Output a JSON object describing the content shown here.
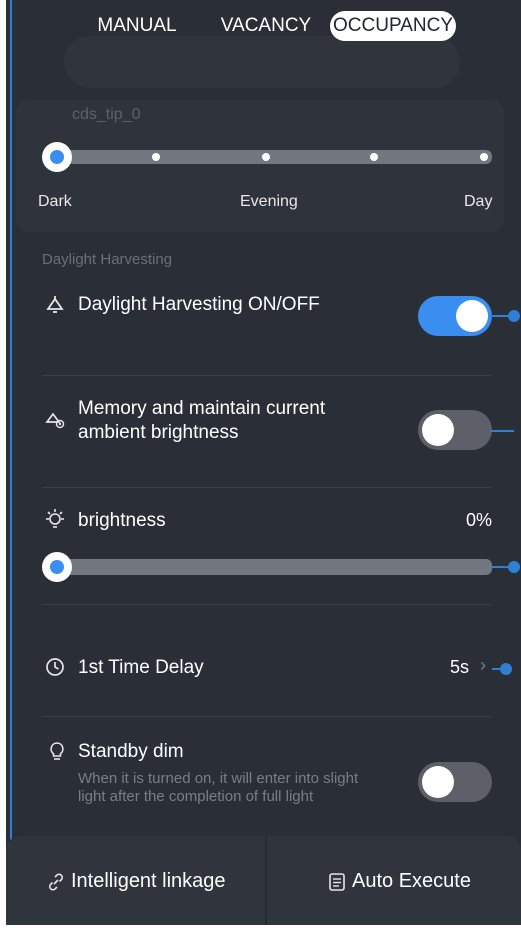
{
  "mode_tabs": [
    "MANUAL",
    "VACANCY",
    "OCCUPANCY"
  ],
  "active_tab": "OCCUPANCY",
  "cds": {
    "tip": "cds_tip_0",
    "labels": [
      "Dark",
      "Evening",
      "Day"
    ],
    "level_index": 0
  },
  "daylight": {
    "section_title": "Daylight Harvesting",
    "onoff_label": "Daylight Harvesting ON/OFF",
    "onoff_state": true,
    "memory_label_line1": "Memory and maintain current",
    "memory_label_line2": "ambient brightness",
    "memory_state": false
  },
  "brightness": {
    "label": "brightness",
    "value_text": "0%",
    "value": 0
  },
  "delay": {
    "label": "1st Time Delay",
    "value_text": "5s",
    "chevron": "›"
  },
  "standby": {
    "label": "Standby dim",
    "description": "When it is turned on, it will enter into slight light after the completion of full light",
    "state": false
  },
  "footer": {
    "intelligent_label": "Intelligent linkage",
    "auto_label": "Auto Execute"
  },
  "colors": {
    "accent": "#3a8ef0",
    "background": "#2a2e36",
    "connector": "#2f7fd4"
  },
  "icons": [
    "lamp-icon",
    "lamp-eye-icon",
    "bulb-rays-icon",
    "clock-icon",
    "bulb-outline-icon",
    "link-icon",
    "document-icon"
  ]
}
